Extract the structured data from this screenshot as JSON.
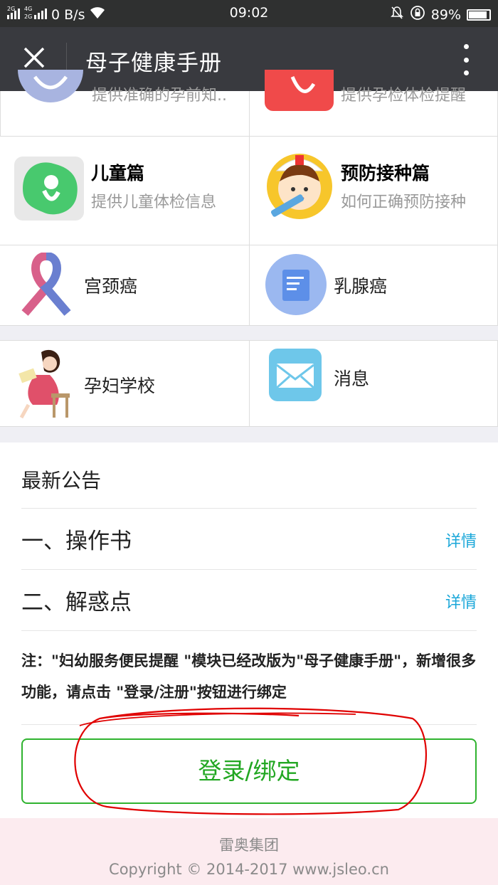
{
  "status": {
    "network_left": "2G 4G 2G",
    "speed": "0 B/s",
    "time": "09:02",
    "battery": "89%",
    "battery_level": 0.89
  },
  "header": {
    "title": "母子健康手册"
  },
  "grid_top_partial": [
    {
      "subtitle": "提供准确的孕前知.."
    },
    {
      "subtitle": "提供孕检体检提醒"
    }
  ],
  "modules": {
    "child": {
      "title": "儿童篇",
      "subtitle": "提供儿童体检信息"
    },
    "vaccine": {
      "title": "预防接种篇",
      "subtitle": "如何正确预防接种"
    },
    "cervical": {
      "label": "宫颈癌"
    },
    "breast": {
      "label": "乳腺癌"
    },
    "school": {
      "label": "孕妇学校"
    },
    "message": {
      "label": "消息"
    }
  },
  "notice": {
    "heading": "最新公告",
    "items": [
      {
        "name": "一、操作书",
        "link": "详情"
      },
      {
        "name": "二、解惑点",
        "link": "详情"
      }
    ],
    "note": "注：\"妇幼服务便民提醒 \"模块已经改版为\"母子健康手册\"，新增很多功能，请点击 \"登录/注册\"按钮进行绑定",
    "button": "登录/绑定"
  },
  "footer": {
    "company": "雷奥集团",
    "copyright": "Copyright © 2014-2017 www.jsleo.cn"
  },
  "colors": {
    "accent_green": "#22a722",
    "link_blue": "#1aa7d9",
    "titlebar": "#393a3f",
    "annotation_red": "#e00000"
  }
}
